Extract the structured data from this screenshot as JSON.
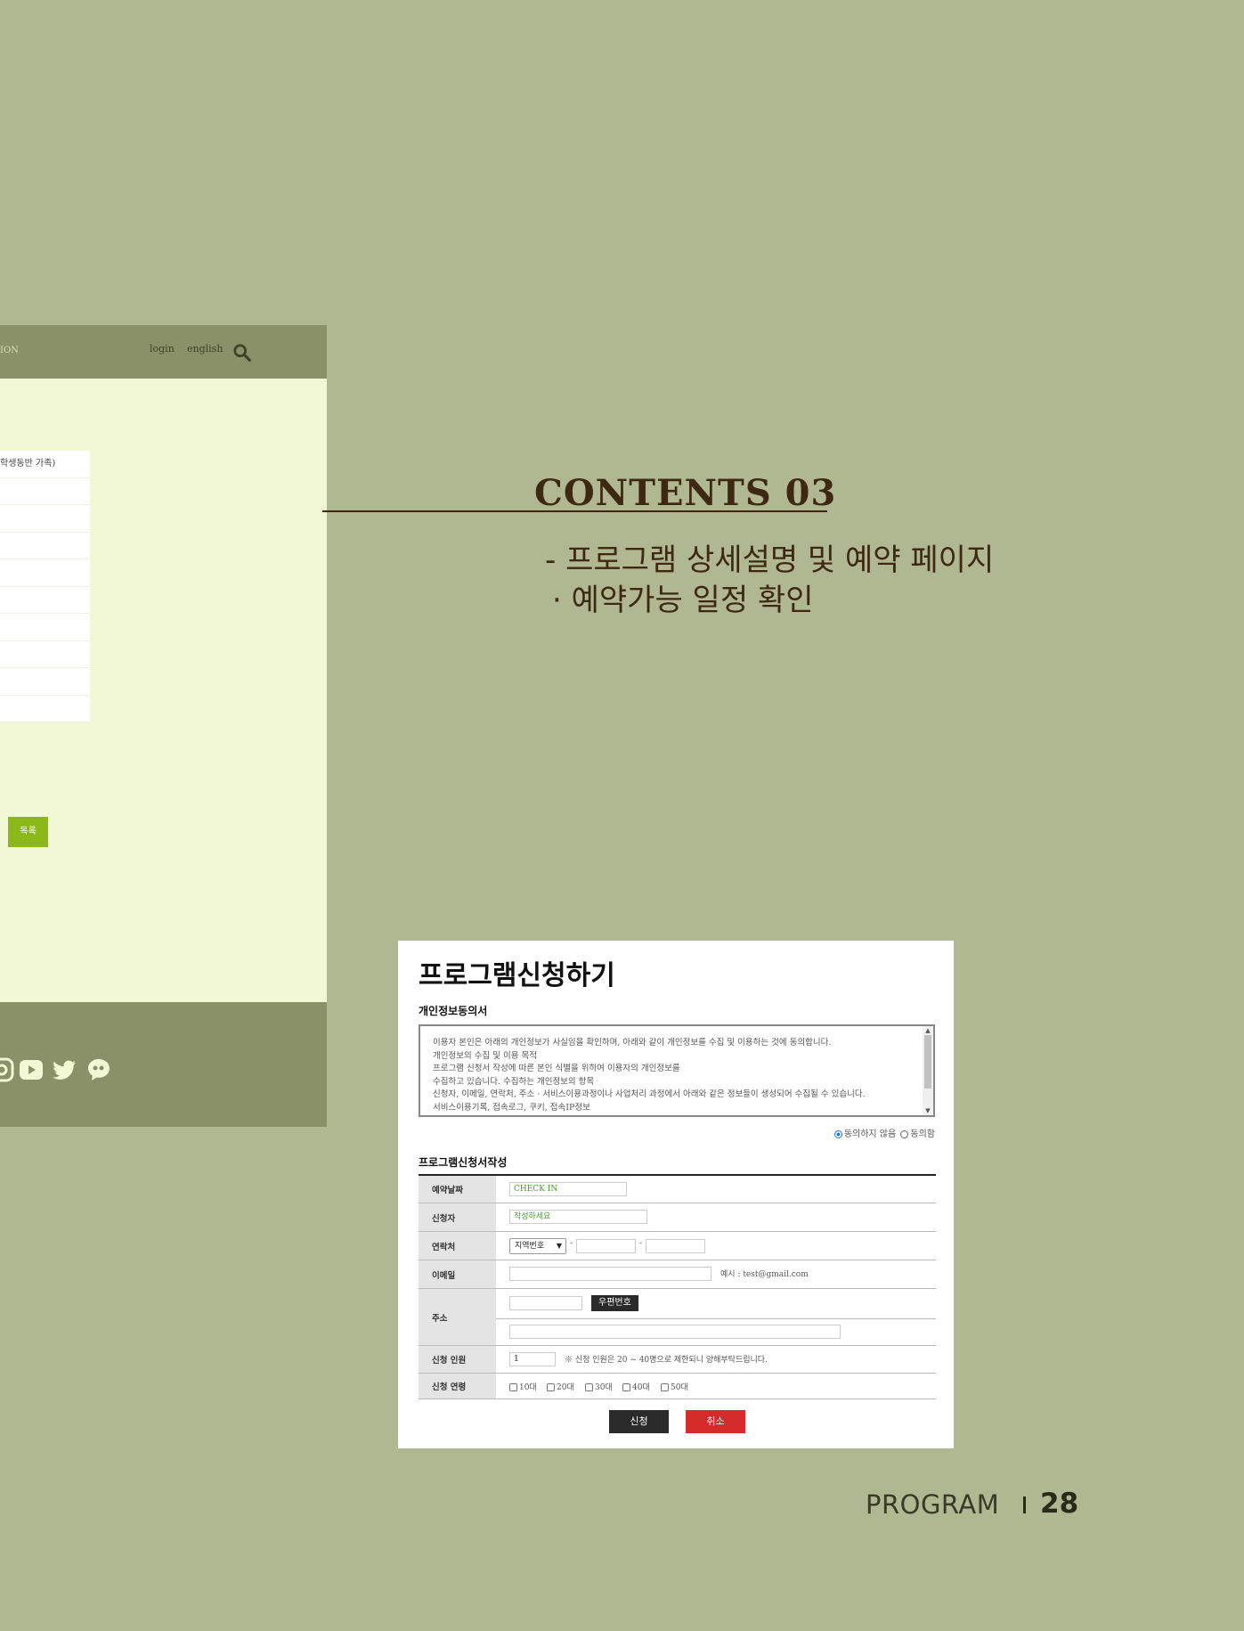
{
  "left_site": {
    "nav_text": "ION",
    "login": "login",
    "english": "english",
    "row1_text": "학생동반 가족)",
    "list_button": "목록"
  },
  "contents": {
    "title": "CONTENTS 03",
    "sub1": "- 프로그램 상세설명 및 예약 페이지",
    "sub2": "· 예약가능 일정 확인"
  },
  "form": {
    "title": "프로그램신청하기",
    "privacy_title": "개인정보동의서",
    "privacy_lines": [
      "이용자 본인은 아래의 개인정보가 사실임을 확인하며, 아래와 같이 개인정보를 수집 및 이용하는 것에 동의합니다.",
      "개인정보의 수집 및 이용 목적",
      "프로그램 신청서 작성에 따른 본인 식별을 위하여 이용자의 개인정보를",
      "수집하고 있습니다. 수집하는 개인정보의 항목",
      "신청자, 이메일, 연락처, 주소 · 서비스이용과정이나 사업처리 과정에서 아래와 같은 정보들이 생성되어 수집될 수 있습니다.",
      "서비스이용기록, 접속로그, 쿠키, 접속IP정보"
    ],
    "consent_no": "동의하지 않음",
    "consent_yes": "동의함",
    "application_title": "프로그램신청서작성",
    "labels": {
      "date": "예약날짜",
      "applicant": "신청자",
      "contact": "연락처",
      "email": "이메일",
      "address": "주소",
      "people": "신청 인원",
      "age": "신청 연령"
    },
    "date_value": "CHECK IN",
    "applicant_placeholder": "작성하세요",
    "area_code": "지역번호",
    "dash": "-",
    "email_example": "예시 : test@gmail.com",
    "zip_button": "우편번호",
    "people_value": "1",
    "people_note": "※ 신청 인원은 20 ~ 40명으로 제한되니 양해부탁드립니다.",
    "age_options": [
      "10대",
      "20대",
      "30대",
      "40대",
      "50대"
    ],
    "submit": "신청",
    "cancel": "취소"
  },
  "footer": {
    "section": "PROGRAM",
    "page_number": "28"
  }
}
